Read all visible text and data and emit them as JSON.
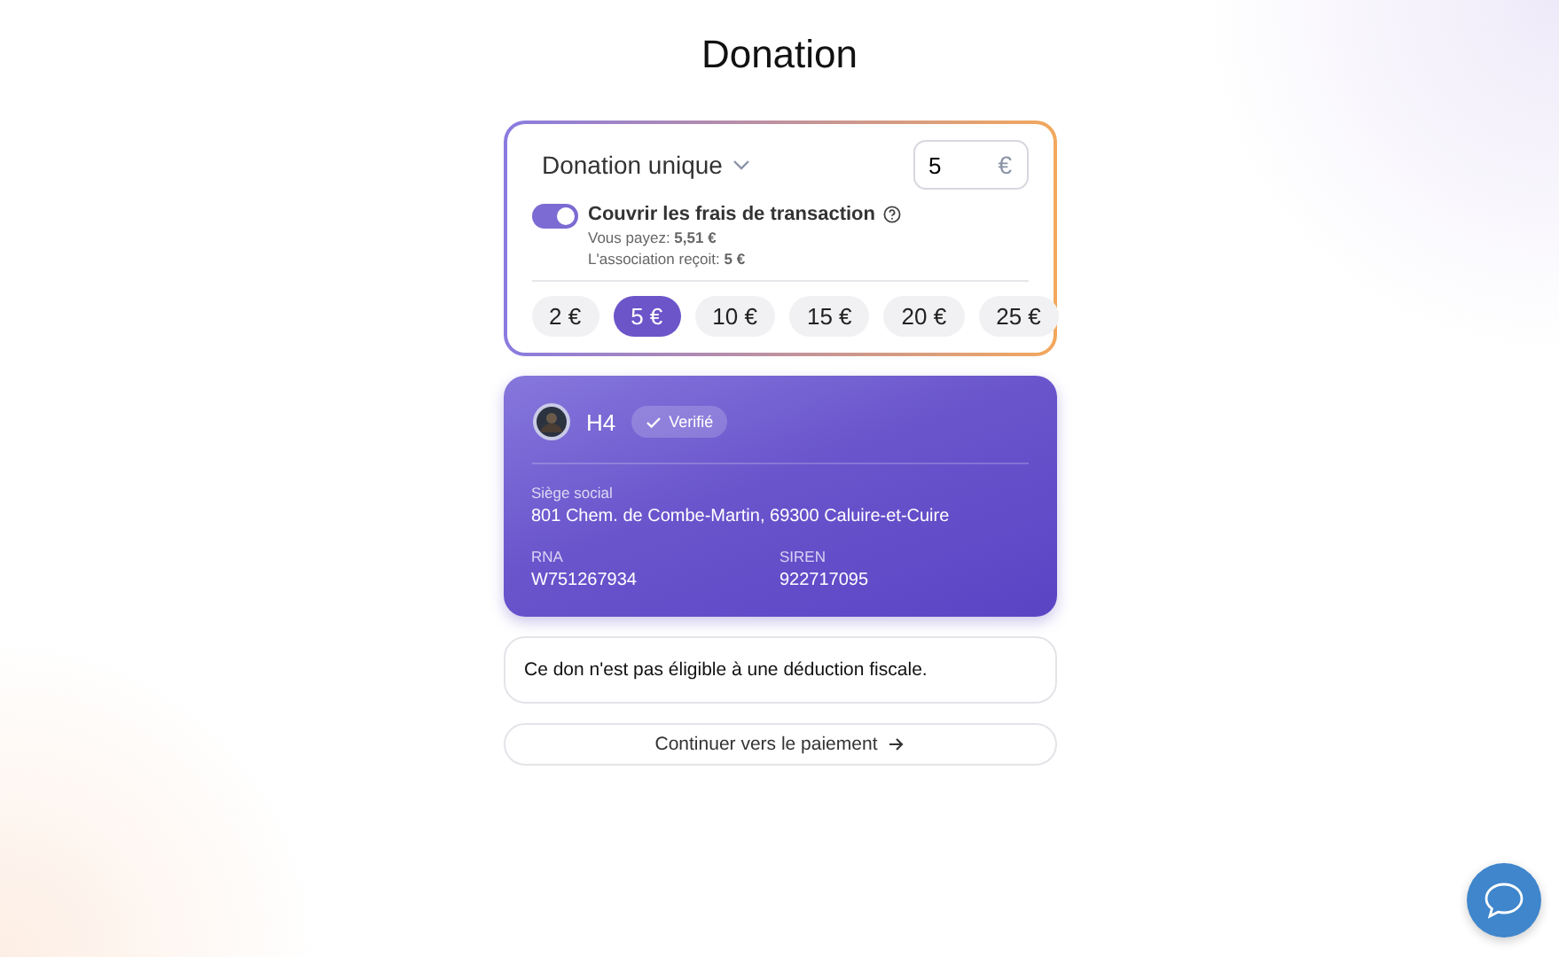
{
  "title": "Donation",
  "donation": {
    "frequency": "Donation unique",
    "amount": "5",
    "currency": "€",
    "cover_fees": {
      "label": "Couvrir les frais de transaction",
      "on": true,
      "details": [
        "Vous payez: **5,51 €**",
        "L'association reçoit: **5 €**"
      ]
    },
    "presets": [
      {
        "label": "2 €",
        "selected": false
      },
      {
        "label": "5 €",
        "selected": true
      },
      {
        "label": "10 €",
        "selected": false
      },
      {
        "label": "15 €",
        "selected": false
      },
      {
        "label": "20 €",
        "selected": false
      },
      {
        "label": "25 €",
        "selected": false
      }
    ]
  },
  "organization": {
    "name": "H4",
    "badge": "Verifié",
    "address": {
      "label": "Siège social",
      "value": "801 Chem. de Combe-Martin, 69300 Caluire-et-Cuire"
    },
    "identifiers": [
      {
        "label": "RNA",
        "value": "W751267934"
      },
      {
        "label": "SIREN",
        "value": "922717095"
      }
    ]
  },
  "notice": "Ce don n'est pas éligible à une déduction fiscale.",
  "continue_button": "Continuer vers le paiement"
}
